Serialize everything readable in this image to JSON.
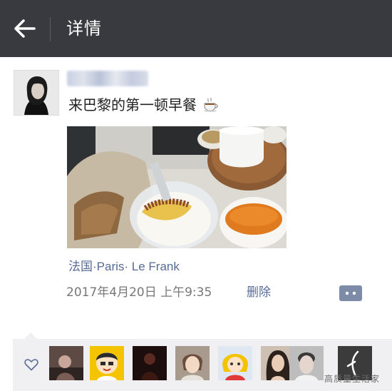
{
  "header": {
    "title": "详情"
  },
  "post": {
    "text": "来巴黎的第一顿早餐",
    "location": "法国·Paris· Le Frank",
    "timestamp": "2017年4月20日 上午9:35",
    "delete_label": "删除"
  },
  "likes": {
    "avatars": [
      "avatar-1",
      "avatar-2",
      "avatar-3",
      "avatar-4",
      "avatar-5",
      "avatar-6",
      "avatar-7",
      "avatar-8"
    ]
  },
  "watermark": "高质量生活家",
  "colors": {
    "topbar": "#393a3f",
    "link": "#576b95",
    "likes_bg": "#f0f0f2"
  }
}
